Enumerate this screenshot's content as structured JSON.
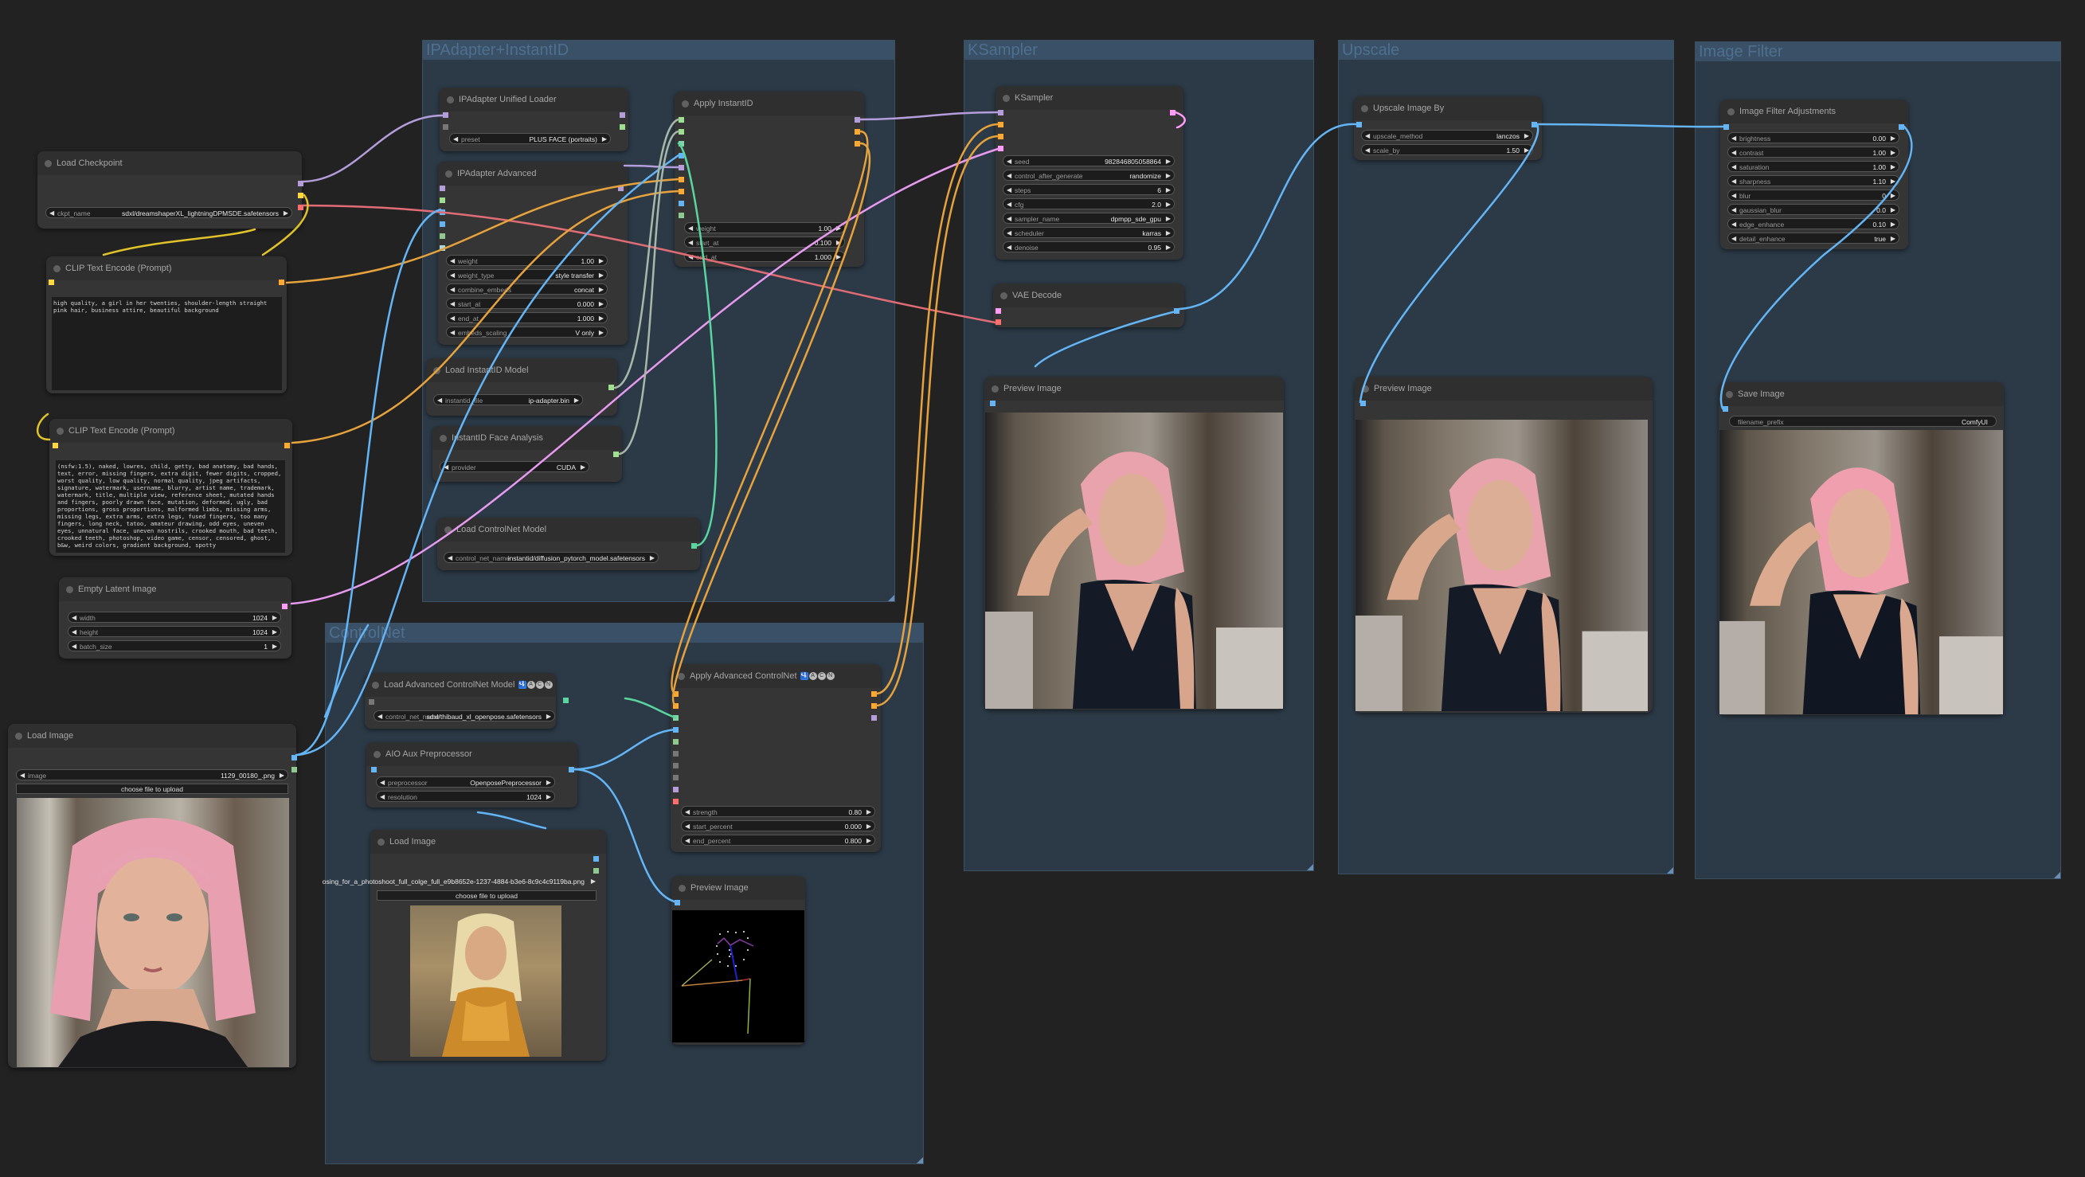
{
  "app": {
    "name": "ComfyUI workflow canvas"
  },
  "colors": {
    "canvas_bg": "#222222",
    "group_bg": "#2c3a47",
    "node_bg": "#353535",
    "link_model": "#b39ddb",
    "link_clip": "#ffd83d",
    "link_vae": "#ff6e6e",
    "link_conditioning": "#ffa931",
    "link_latent": "#ff9cf9",
    "link_image": "#64b5f6",
    "link_controlnet": "#5ad5a0",
    "link_ipadapter": "#9ee090",
    "link_insightface": "#a0b0a0"
  },
  "groups": {
    "ipadapter": {
      "title": "IPAdapter+InstantID"
    },
    "controlnet": {
      "title": "ControlNet"
    },
    "ksampler": {
      "title": "KSampler"
    },
    "upscale": {
      "title": "Upscale"
    },
    "image_filter": {
      "title": "Image Filter"
    }
  },
  "nodes": {
    "load_checkpoint": {
      "title": "Load Checkpoint",
      "widgets": [
        {
          "label": "ckpt_name",
          "value": "sdxl/dreamshaperXL_lightningDPMSDE.safetensors"
        }
      ]
    },
    "clip_pos": {
      "title": "CLIP Text Encode (Prompt)",
      "text": "high quality, a girl in her twenties, shoulder-length straight pink hair, business attire, beautiful background"
    },
    "clip_neg": {
      "title": "CLIP Text Encode (Prompt)",
      "text": "(nsfw:1.5), naked, lowres, child, getty, bad anatomy, bad hands, text, error, missing fingers, extra digit, fewer digits, cropped, worst quality, low quality, normal quality, jpeg artifacts, signature, watermark, username, blurry, artist name, trademark, watermark, title, multiple view, reference sheet, mutated hands and fingers, poorly drawn face, mutation, deformed, ugly, bad proportions, gross proportions, malformed limbs, missing arms, missing legs, extra arms, extra legs, fused fingers, too many fingers, long neck, tatoo, amateur drawing, odd eyes, uneven eyes, unnatural face, uneven nostrils, crooked mouth, bad teeth, crooked teeth, photoshop, video game, censor, censored, ghost, b&w, weird colors, gradient background, spotty"
    },
    "empty_latent": {
      "title": "Empty Latent Image",
      "widgets": [
        {
          "label": "width",
          "value": "1024"
        },
        {
          "label": "height",
          "value": "1024"
        },
        {
          "label": "batch_size",
          "value": "1"
        }
      ]
    },
    "load_image_ref": {
      "title": "Load Image",
      "widgets": [
        {
          "label": "image",
          "value": "1129_00180_.png"
        }
      ],
      "upload_label": "choose file to upload"
    },
    "ipa_loader": {
      "title": "IPAdapter Unified Loader",
      "widgets": [
        {
          "label": "preset",
          "value": "PLUS FACE (portraits)"
        }
      ]
    },
    "ipa_advanced": {
      "title": "IPAdapter Advanced",
      "widgets": [
        {
          "label": "weight",
          "value": "1.00"
        },
        {
          "label": "weight_type",
          "value": "style transfer"
        },
        {
          "label": "combine_embeds",
          "value": "concat"
        },
        {
          "label": "start_at",
          "value": "0.000"
        },
        {
          "label": "end_at",
          "value": "1.000"
        },
        {
          "label": "embeds_scaling",
          "value": "V only"
        }
      ]
    },
    "apply_instantid": {
      "title": "Apply InstantID",
      "widgets": [
        {
          "label": "weight",
          "value": "1.00"
        },
        {
          "label": "start_at",
          "value": "0.100"
        },
        {
          "label": "end_at",
          "value": "1.000"
        }
      ]
    },
    "load_instantid": {
      "title": "Load InstantID Model",
      "widgets": [
        {
          "label": "instantid_file",
          "value": "ip-adapter.bin"
        }
      ]
    },
    "face_analysis": {
      "title": "InstantID Face Analysis",
      "widgets": [
        {
          "label": "provider",
          "value": "CUDA"
        }
      ]
    },
    "load_controlnet": {
      "title": "Load ControlNet Model",
      "widgets": [
        {
          "label": "control_net_name",
          "value": "instantid/diffusion_pytorch_model.safetensors"
        }
      ]
    },
    "load_adv_controlnet": {
      "title": "Load Advanced ControlNet Model",
      "badges": [
        "🛂",
        "A",
        "C",
        "N"
      ],
      "widgets": [
        {
          "label": "control_net_name",
          "value": "sdxl/thibaud_xl_openpose.safetensors"
        }
      ]
    },
    "aio_preprocessor": {
      "title": "AIO Aux Preprocessor",
      "widgets": [
        {
          "label": "preprocessor",
          "value": "OpenposePreprocessor"
        },
        {
          "label": "resolution",
          "value": "1024"
        }
      ]
    },
    "load_image_pose": {
      "title": "Load Image",
      "filename_overflow": "osing_for_a_photoshoot_full_colge_full_e9b8652e-1237-4884-b3e6-8c9c4c9119ba.png",
      "upload_label": "choose file to upload"
    },
    "apply_adv_controlnet": {
      "title": "Apply Advanced ControlNet",
      "badges": [
        "🛂",
        "A",
        "C",
        "N"
      ],
      "widgets": [
        {
          "label": "strength",
          "value": "0.80"
        },
        {
          "label": "start_percent",
          "value": "0.000"
        },
        {
          "label": "end_percent",
          "value": "0.800"
        }
      ]
    },
    "preview_pose": {
      "title": "Preview Image"
    },
    "ksampler": {
      "title": "KSampler",
      "widgets": [
        {
          "label": "seed",
          "value": "982846805058864"
        },
        {
          "label": "control_after_generate",
          "value": "randomize"
        },
        {
          "label": "steps",
          "value": "6"
        },
        {
          "label": "cfg",
          "value": "2.0"
        },
        {
          "label": "sampler_name",
          "value": "dpmpp_sde_gpu"
        },
        {
          "label": "scheduler",
          "value": "karras"
        },
        {
          "label": "denoise",
          "value": "0.95"
        }
      ]
    },
    "vae_decode": {
      "title": "VAE Decode"
    },
    "preview_ks": {
      "title": "Preview Image"
    },
    "upscale_by": {
      "title": "Upscale Image By",
      "widgets": [
        {
          "label": "upscale_method",
          "value": "lanczos"
        },
        {
          "label": "scale_by",
          "value": "1.50"
        }
      ]
    },
    "preview_up": {
      "title": "Preview Image"
    },
    "filter_adj": {
      "title": "Image Filter Adjustments",
      "widgets": [
        {
          "label": "brightness",
          "value": "0.00"
        },
        {
          "label": "contrast",
          "value": "1.00"
        },
        {
          "label": "saturation",
          "value": "1.00"
        },
        {
          "label": "sharpness",
          "value": "1.10"
        },
        {
          "label": "blur",
          "value": "0"
        },
        {
          "label": "gaussian_blur",
          "value": "0.0"
        },
        {
          "label": "edge_enhance",
          "value": "0.10"
        },
        {
          "label": "detail_enhance",
          "value": "true"
        }
      ]
    },
    "save_image": {
      "title": "Save Image",
      "widgets": [
        {
          "label": "filename_prefix",
          "value": "ComfyUI"
        }
      ]
    }
  },
  "icons": {
    "arrow_left": "◀",
    "arrow_right": "▶"
  }
}
